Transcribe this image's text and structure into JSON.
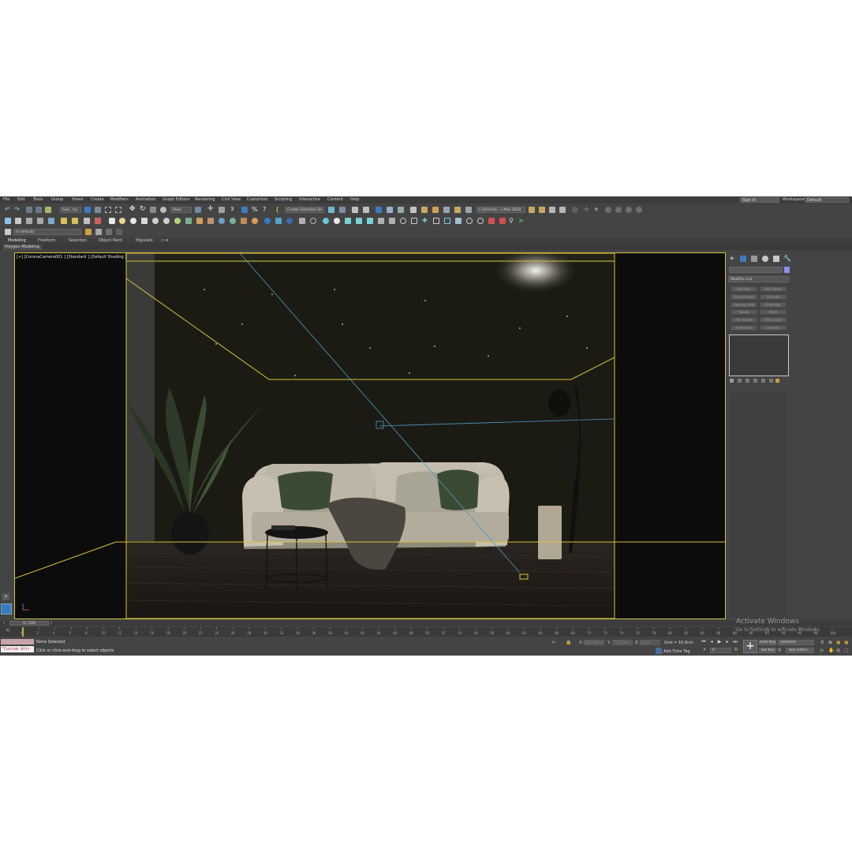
{
  "menu": {
    "items": [
      "File",
      "Edit",
      "Tools",
      "Group",
      "Views",
      "Create",
      "Modifiers",
      "Animation",
      "Graph Editors",
      "Rendering",
      "Civil View",
      "Customize",
      "Scripting",
      "Interactive",
      "Content",
      "Help"
    ],
    "sign_in": "Sign In",
    "workspace_label": "Workspaces:",
    "workspace_value": "Default"
  },
  "toolbar1": {
    "selection_filter": "Geo...try",
    "ref_coord": "View",
    "named_selection": "Create Selection Se",
    "project_path": "C:\\Users\\h...s Max 2020"
  },
  "toolbar3": {
    "layer_value": "0 (default)"
  },
  "ribbon": {
    "tabs": [
      "Modeling",
      "Freeform",
      "Selection",
      "Object Paint",
      "Populate"
    ],
    "panel_label": "Polygon Modeling"
  },
  "viewport": {
    "label": "[+] [CoronaCamera001 ] [Standard ] [Default Shading ]"
  },
  "command_panel": {
    "modifier_list": "Modifier List",
    "buttons": [
      "Edit Poly",
      "Edit Spline",
      "TurboSmooth",
      "Extrude",
      "Unwrap UVW",
      "UVW Map",
      "Sweep",
      "Shell",
      "FFD 4x4x4",
      "FFD 3x3x3",
      "Symmetry",
      "Chamfer"
    ]
  },
  "timeline": {
    "position": "0 / 100",
    "ticks": [
      "0",
      "2",
      "4",
      "6",
      "8",
      "10",
      "12",
      "14",
      "16",
      "18",
      "20",
      "22",
      "24",
      "26",
      "28",
      "30",
      "32",
      "34",
      "36",
      "38",
      "40",
      "42",
      "44",
      "46",
      "48",
      "50",
      "52",
      "54",
      "56",
      "58",
      "60",
      "62",
      "64",
      "66",
      "68",
      "70",
      "72",
      "74",
      "76",
      "78",
      "80",
      "82",
      "84",
      "86",
      "88",
      "90",
      "92",
      "94",
      "96",
      "98",
      "100"
    ]
  },
  "status": {
    "maxscript_text": "\"Custom Attr",
    "selection": "None Selected",
    "prompt": "Click or click-and-drag to select objects",
    "x_label": "X:",
    "x_value": "642.564cm",
    "y_label": "Y:",
    "y_value": "77.653cm",
    "z_label": "Z:",
    "z_value": "0.0cm",
    "grid": "Grid = 10.0cm",
    "add_time_tag": "Add Time Tag",
    "auto_key": "Auto Key",
    "set_key": "Set Key",
    "selected": "Selected",
    "key_filters": "Key Filters...",
    "frame": "0"
  },
  "watermark": {
    "title": "Activate Windows",
    "subtitle": "Go to Settings to activate Windows."
  },
  "colors": {
    "ui_bg": "#444444",
    "viewport_border": "#d8c23a",
    "accent_blue": "#3a7bbf"
  }
}
